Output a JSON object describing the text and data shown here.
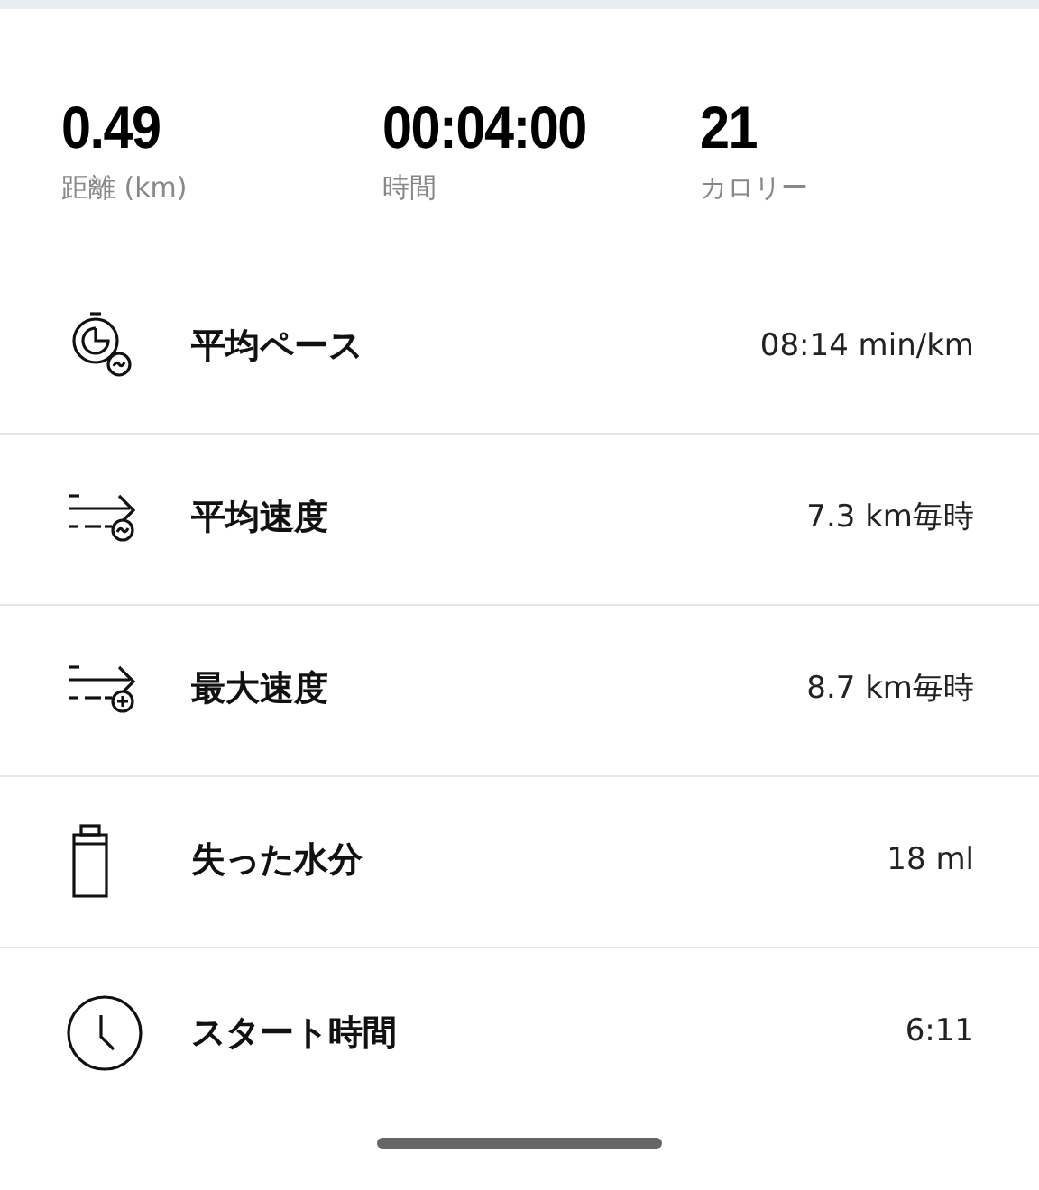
{
  "summary": [
    {
      "value": "0.49",
      "label": "距離 (km)"
    },
    {
      "value": "00:04:00",
      "label": "時間"
    },
    {
      "value": "21",
      "label": "カロリー"
    }
  ],
  "metrics": [
    {
      "kind": "pace",
      "label": "平均ペース",
      "value": "08:14 min/km"
    },
    {
      "kind": "avg_speed",
      "label": "平均速度",
      "value": "7.3 km毎時"
    },
    {
      "kind": "max_speed",
      "label": "最大速度",
      "value": "8.7 km毎時"
    },
    {
      "kind": "water",
      "label": "失った水分",
      "value": "18 ml"
    },
    {
      "kind": "start",
      "label": "スタート時間",
      "value": "6:11"
    }
  ]
}
